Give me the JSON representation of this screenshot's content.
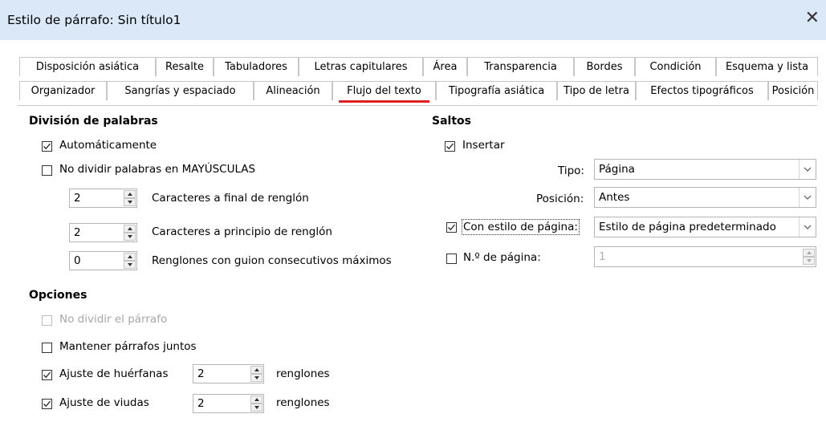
{
  "window": {
    "title": "Estilo de párrafo: Sin título1",
    "close_label": "✕"
  },
  "tabs": {
    "row1": [
      "Disposición asiática",
      "Resalte",
      "Tabuladores",
      "Letras capitulares",
      "Área",
      "Transparencia",
      "Bordes",
      "Condición",
      "Esquema y lista"
    ],
    "row2": [
      "Organizador",
      "Sangrías y espaciado",
      "Alineación",
      "Flujo del texto",
      "Tipografía asiática",
      "Tipo de letra",
      "Efectos tipográficos",
      "Posición"
    ],
    "active": "Flujo del texto",
    "accent": "#e02020"
  },
  "hyphenation": {
    "header": "División de palabras",
    "automatic": {
      "label": "Automáticamente",
      "checked": true
    },
    "no_caps": {
      "label": "No dividir palabras en MAYÚSCULAS",
      "checked": false
    },
    "chars_end": {
      "value": "2",
      "label": "Caracteres a final de renglón"
    },
    "chars_start": {
      "value": "2",
      "label": "Caracteres a principio de renglón"
    },
    "max_consecutive": {
      "value": "0",
      "label": "Renglones con guion consecutivos máximos"
    }
  },
  "breaks": {
    "header": "Saltos",
    "insert": {
      "label": "Insertar",
      "checked": true
    },
    "type": {
      "label": "Tipo:",
      "value": "Página"
    },
    "position": {
      "label": "Posición:",
      "value": "Antes"
    },
    "with_page_style": {
      "label": "Con estilo de página:",
      "checked": true,
      "value": "Estilo de página predeterminado"
    },
    "page_number": {
      "label": "N.º de página:",
      "checked": false,
      "value": "1"
    }
  },
  "options": {
    "header": "Opciones",
    "dont_split": {
      "label": "No dividir el párrafo",
      "checked": false,
      "disabled": true
    },
    "keep_together": {
      "label": "Mantener párrafos juntos",
      "checked": false
    },
    "orphan": {
      "label": "Ajuste de huérfanas",
      "checked": true,
      "value": "2",
      "unit": "renglones"
    },
    "widow": {
      "label": "Ajuste de viudas",
      "checked": true,
      "value": "2",
      "unit": "renglones"
    }
  }
}
